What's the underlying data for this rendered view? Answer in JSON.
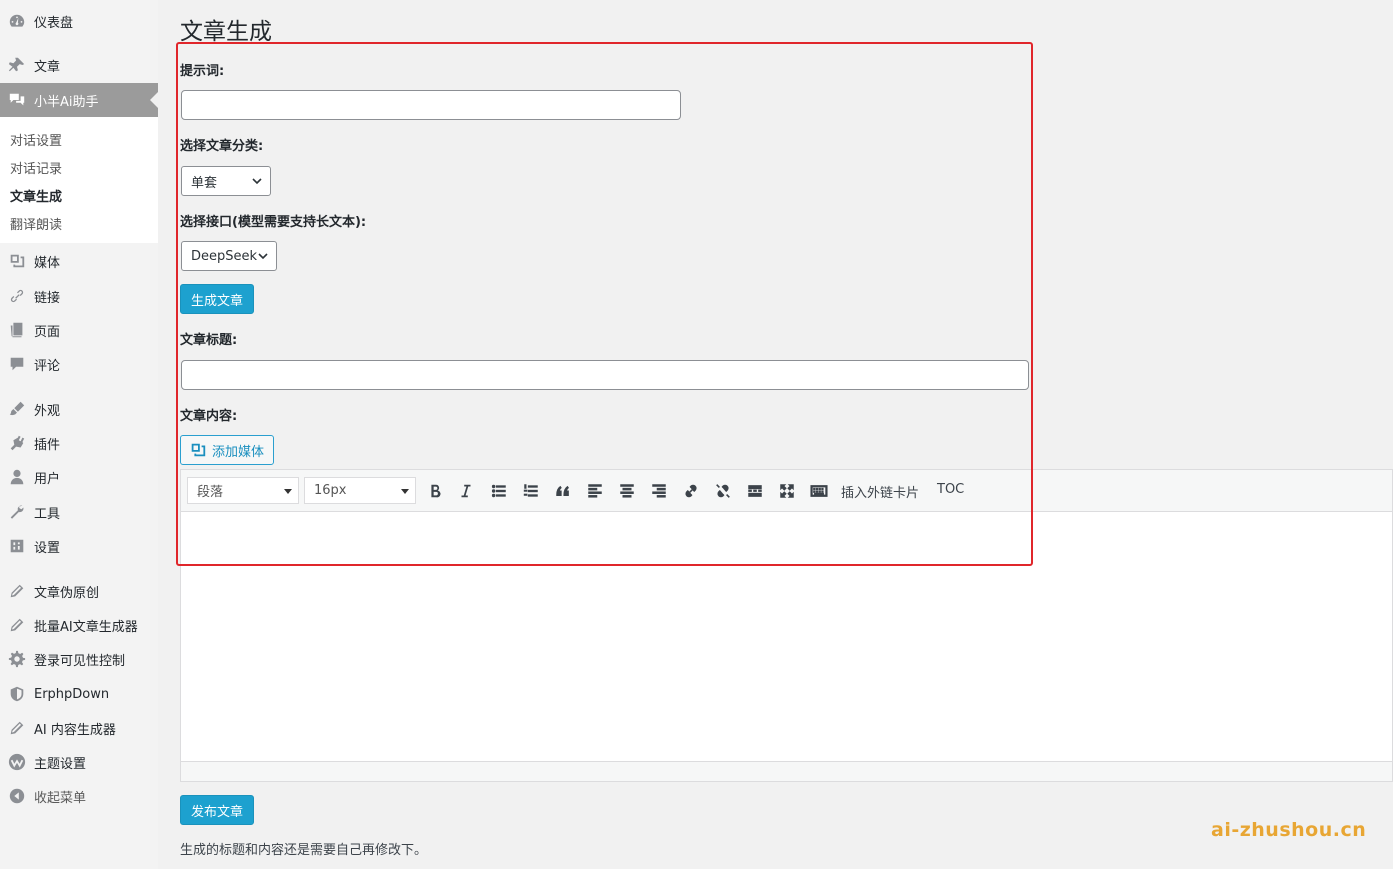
{
  "sidebar": {
    "items": [
      {
        "label": "仪表盘",
        "icon": "dashboard-icon"
      },
      {
        "label": "文章",
        "icon": "pin-icon"
      },
      {
        "label": "小半Ai助手",
        "icon": "comments-icon"
      },
      {
        "label": "媒体",
        "icon": "media-icon"
      },
      {
        "label": "链接",
        "icon": "link-icon"
      },
      {
        "label": "页面",
        "icon": "page-icon"
      },
      {
        "label": "评论",
        "icon": "comment-icon"
      },
      {
        "label": "外观",
        "icon": "brush-icon"
      },
      {
        "label": "插件",
        "icon": "plugin-icon"
      },
      {
        "label": "用户",
        "icon": "user-icon"
      },
      {
        "label": "工具",
        "icon": "wrench-icon"
      },
      {
        "label": "设置",
        "icon": "settings-icon"
      },
      {
        "label": "文章伪原创",
        "icon": "pencil-icon"
      },
      {
        "label": "批量AI文章生成器",
        "icon": "pencil-icon"
      },
      {
        "label": "登录可见性控制",
        "icon": "gear-icon"
      },
      {
        "label": "ErphpDown",
        "icon": "shield-icon"
      },
      {
        "label": "AI 内容生成器",
        "icon": "pencil-icon"
      },
      {
        "label": "主题设置",
        "icon": "theme-icon"
      },
      {
        "label": "收起菜单",
        "icon": "collapse-icon"
      }
    ],
    "submenu": [
      "对话设置",
      "对话记录",
      "文章生成",
      "翻译朗读"
    ]
  },
  "main": {
    "title": "文章生成",
    "prompt_label": "提示词:",
    "prompt_value": "",
    "category_label": "选择文章分类:",
    "category_value": "单套",
    "api_label": "选择接口(模型需要支持长文本):",
    "api_value": "DeepSeek",
    "generate_button": "生成文章",
    "article_title_label": "文章标题:",
    "article_title_value": "",
    "content_label": "文章内容:",
    "add_media_button": "添加媒体",
    "publish_button": "发布文章",
    "note": "生成的标题和内容还是需要自己再修改下。"
  },
  "editor": {
    "format_select": "段落",
    "size_select": "16px",
    "insert_link_card": "插入外链卡片",
    "toc": "TOC",
    "content": ""
  },
  "watermark": "ai-zhushou.cn",
  "colors": {
    "accent": "#1da1cf",
    "highlight_border": "#e0262b",
    "watermark": "#e8a634"
  }
}
